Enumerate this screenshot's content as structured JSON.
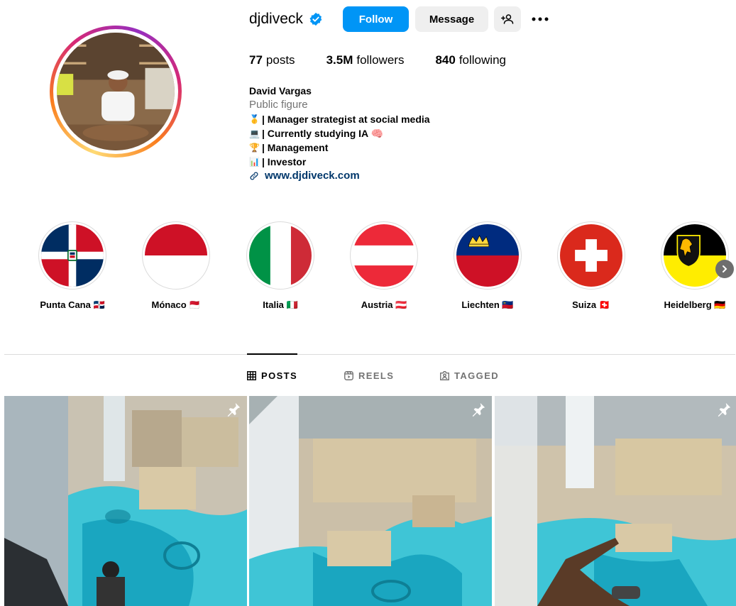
{
  "profile": {
    "username": "djdiveck",
    "verified": true,
    "follow_label": "Follow",
    "message_label": "Message",
    "add_user_icon": "person-plus-icon",
    "more_icon": "ellipsis-icon"
  },
  "stats": {
    "posts_count": "77",
    "posts_label": "posts",
    "followers_count": "3.5M",
    "followers_label": "followers",
    "following_count": "840",
    "following_label": "following"
  },
  "bio": {
    "name": "David Vargas",
    "category": "Public figure",
    "lines": [
      {
        "emoji": "🥇",
        "text": "| Manager strategist at social media"
      },
      {
        "emoji": "💻",
        "text": "| Currently studying IA 🧠"
      },
      {
        "emoji": "🏆",
        "text": "| Management"
      },
      {
        "emoji": "📊",
        "text": "| Investor"
      }
    ],
    "link": "www.djdiveck.com"
  },
  "highlights": [
    {
      "label": "Punta Cana 🇩🇴",
      "flag": "dominican-republic"
    },
    {
      "label": "Mónaco 🇲🇨",
      "flag": "monaco"
    },
    {
      "label": "Italia 🇮🇹",
      "flag": "italy"
    },
    {
      "label": "Austria 🇦🇹",
      "flag": "austria"
    },
    {
      "label": "Liechten 🇱🇮",
      "flag": "liechtenstein"
    },
    {
      "label": "Suiza 🇨🇭",
      "flag": "switzerland"
    },
    {
      "label": "Heidelberg 🇩🇪",
      "flag": "heidelberg"
    }
  ],
  "tabs": [
    {
      "label": "POSTS",
      "active": true,
      "icon": "grid-icon"
    },
    {
      "label": "REELS",
      "active": false,
      "icon": "reels-icon"
    },
    {
      "label": "TAGGED",
      "active": false,
      "icon": "tagged-icon"
    }
  ],
  "posts": [
    {
      "pinned": true,
      "subject": "aerial view of Dubai fountain from Burj Khalifa"
    },
    {
      "pinned": true,
      "subject": "aerial view of downtown Dubai"
    },
    {
      "pinned": true,
      "subject": "hand pointing at Dubai fountain from above"
    }
  ],
  "colors": {
    "accent": "#0095f6",
    "link": "#00376b",
    "muted": "#737373",
    "button_gray": "#efefef",
    "border": "#dbdbdb"
  }
}
